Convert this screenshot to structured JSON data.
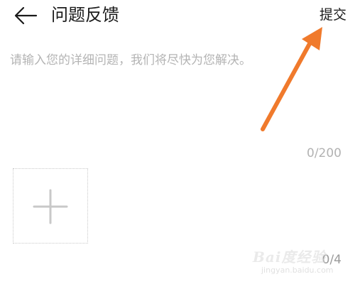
{
  "header": {
    "back_icon": "arrow-left-icon",
    "title": "问题反馈",
    "submit_label": "提交"
  },
  "feedback": {
    "placeholder": "请输入您的详细问题，我们将尽快为您解决。",
    "value": "",
    "counter": "0/200"
  },
  "images": {
    "add_icon": "plus-icon",
    "counter": "0/4"
  },
  "annotation": {
    "arrow_color": "#f07a2c"
  },
  "watermark": {
    "brand": "Bai度经验",
    "url": "jingyan.baidu.com"
  },
  "colors": {
    "placeholder": "#b4b4b4",
    "counter": "#b2b2b2",
    "title": "#1a1a1a"
  }
}
